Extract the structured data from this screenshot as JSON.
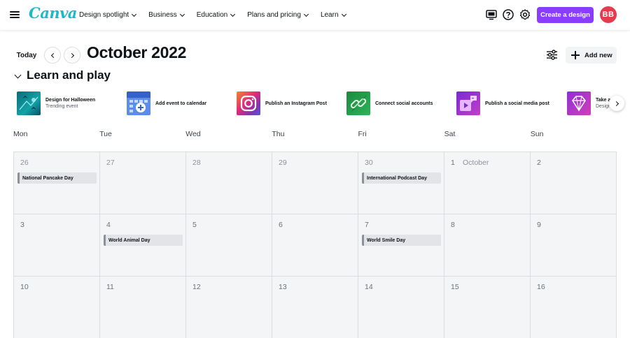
{
  "app": {
    "logo": "Canva",
    "brand_color": "#8b3dff",
    "logo_color": "#1fb8c9"
  },
  "nav": {
    "menu": [
      {
        "label": "Design spotlight"
      },
      {
        "label": "Business"
      },
      {
        "label": "Education"
      },
      {
        "label": "Plans and pricing"
      },
      {
        "label": "Learn"
      }
    ],
    "icons": [
      "presentation-icon",
      "help-icon",
      "settings-icon"
    ],
    "create_label": "Create a design",
    "avatar_initials": "BB",
    "avatar_color": "#e43b4f"
  },
  "header": {
    "today_label": "Today",
    "month_title": "October 2022",
    "add_new_label": "Add new"
  },
  "section": {
    "title": "Learn and play",
    "cards": [
      {
        "title": "Design for Halloween",
        "subtitle": "Trending event",
        "icon": "halloween-thumb"
      },
      {
        "title": "Add event to calendar",
        "subtitle": "",
        "icon": "calendar-add-thumb"
      },
      {
        "title": "Publish an Instagram Post",
        "subtitle": "",
        "icon": "instagram-thumb"
      },
      {
        "title": "Connect social accounts",
        "subtitle": "",
        "icon": "link-thumb"
      },
      {
        "title": "Publish a social media post",
        "subtitle": "",
        "icon": "social-post-thumb"
      },
      {
        "title": "Take a",
        "subtitle": "Design",
        "icon": "diamond-thumb"
      }
    ]
  },
  "calendar": {
    "weekdays": [
      "Mon",
      "Tue",
      "Wed",
      "Thu",
      "Fri",
      "Sat",
      "Sun"
    ],
    "weeks": [
      [
        {
          "day": "26",
          "event": "National Pancake Day"
        },
        {
          "day": "27"
        },
        {
          "day": "28"
        },
        {
          "day": "29"
        },
        {
          "day": "30",
          "event": "International Podcast Day"
        },
        {
          "day": "1",
          "month": "October",
          "current": true
        },
        {
          "day": "2",
          "current": true
        }
      ],
      [
        {
          "day": "3",
          "current": true
        },
        {
          "day": "4",
          "event": "World Animal Day",
          "current": true
        },
        {
          "day": "5",
          "current": true
        },
        {
          "day": "6",
          "current": true
        },
        {
          "day": "7",
          "event": "World Smile Day",
          "current": true
        },
        {
          "day": "8",
          "current": true
        },
        {
          "day": "9",
          "current": true
        }
      ],
      [
        {
          "day": "10",
          "current": true
        },
        {
          "day": "11",
          "current": true
        },
        {
          "day": "12",
          "current": true
        },
        {
          "day": "13",
          "current": true
        },
        {
          "day": "14",
          "current": true
        },
        {
          "day": "15",
          "current": true
        },
        {
          "day": "16",
          "current": true
        }
      ]
    ]
  }
}
